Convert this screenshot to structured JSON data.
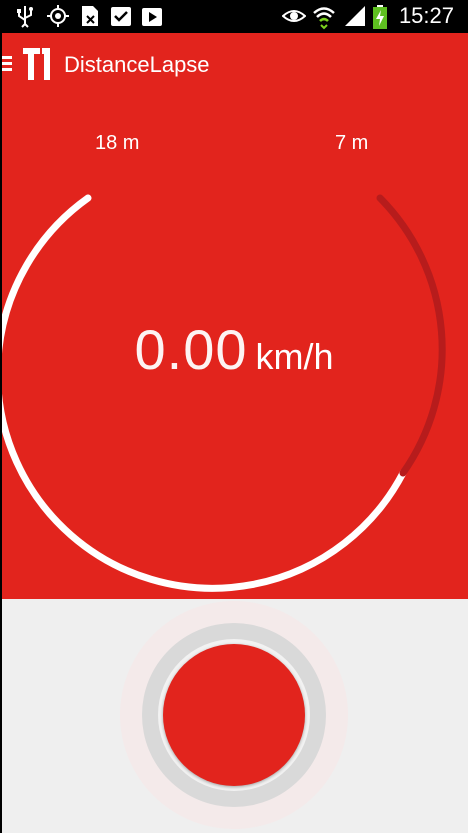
{
  "status_bar": {
    "time": "15:27",
    "left_icons": [
      "usb-icon",
      "gps-icon",
      "sim-icon",
      "checkbox-icon",
      "play-store-icon"
    ],
    "right_icons": [
      "eye-icon",
      "wifi-icon",
      "signal-icon",
      "battery-charging-icon"
    ]
  },
  "app_bar": {
    "title": "DistanceLapse",
    "menu_icon": "hamburger-menu-icon",
    "logo_icon": "app-logo-icon"
  },
  "gauge": {
    "distance_left": "18 m",
    "distance_right": "7 m",
    "speed_value": "0.00",
    "speed_unit": "km/h",
    "colors": {
      "background": "#e2241d",
      "arc_primary": "#ffffff",
      "arc_secondary": "#b71c1c"
    }
  },
  "record_button": {
    "icon": "record-button",
    "color": "#e2241d"
  }
}
